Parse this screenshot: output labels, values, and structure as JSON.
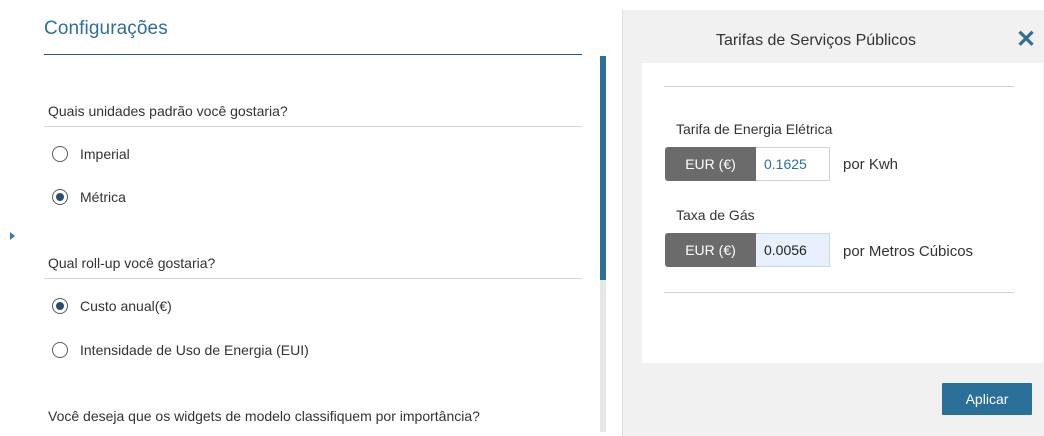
{
  "settings": {
    "title": "Configurações",
    "units_question": "Quais unidades padrão você gostaria?",
    "units_options": [
      "Imperial",
      "Métrica"
    ],
    "units_selected": "Métrica",
    "rollup_question": "Qual roll-up você gostaria?",
    "rollup_options": [
      "Custo anual(€)",
      "Intensidade de Uso de Energia (EUI)"
    ],
    "rollup_selected": "Custo anual(€)",
    "widgets_question": "Você deseja que os widgets de modelo classifiquem por importância?"
  },
  "utility_panel": {
    "title": "Tarifas de Serviços Públicos",
    "close_glyph": "✕",
    "electric": {
      "label": "Tarifa de Energia Elétrica",
      "currency": "EUR (€)",
      "value": "0.1625",
      "unit": "por Kwh"
    },
    "gas": {
      "label": "Taxa de Gás",
      "currency": "EUR (€)",
      "value": "0.0056",
      "unit": "por Metros Cúbicos"
    },
    "apply_label": "Aplicar"
  },
  "colors": {
    "accent": "#2f6f98",
    "currency_bg": "#6b6b6b",
    "focused_input_bg": "#e8f0fb"
  }
}
